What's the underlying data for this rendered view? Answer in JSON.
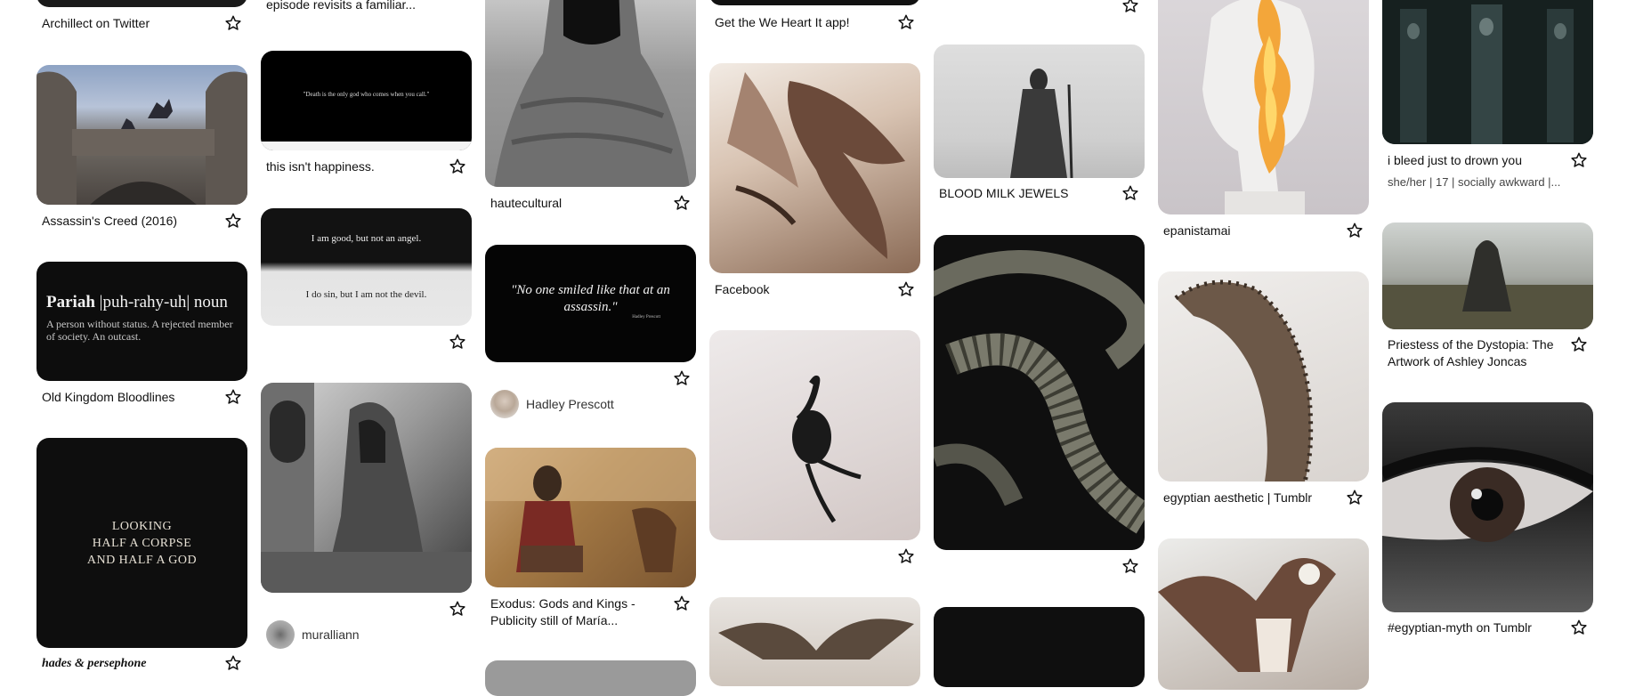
{
  "pins": {
    "c1": {
      "archillect": "Archillect on Twitter",
      "assassins": "Assassin's Creed (2016)",
      "pariah_word": "Pariah",
      "pariah_pron": "|puh-rahy-uh|",
      "pariah_pos": "noun",
      "pariah_def": "A person without status. A rejected member of society. An outcast.",
      "old_kingdom": "Old Kingdom Bloodlines",
      "looking_1": "LOOKING",
      "looking_2": "HALF A CORPSE",
      "looking_3": "AND HALF A GOD",
      "hades": "hades & persephone"
    },
    "c2": {
      "episode": "episode revisits a familiar...",
      "death_quote": "\"Death is the only god who comes when you call.\"",
      "happiness": "this isn't happiness.",
      "good_line1": "I am good, but not an angel.",
      "good_line2": "I do sin, but I am not the devil.",
      "user": "muralliann"
    },
    "c3": {
      "hautecultural": "hautecultural",
      "assassin_quote": "\"No one smiled like that at an assassin.\"",
      "assassin_attr": "Hadley Prescott",
      "user": "Hadley Prescott",
      "exodus": "Exodus: Gods and Kings - Publicity still of María..."
    },
    "c4": {
      "weheartit": "Get the We Heart It app!",
      "facebook": "Facebook"
    },
    "c5": {
      "blood_milk": "BLOOD MILK JEWELS"
    },
    "c6": {
      "epanistamai": "epanistamai",
      "egyptian": "egyptian aesthetic | Tumblr"
    },
    "c7": {
      "bleed": "i bleed just to drown you",
      "bleed_sub": "she/her | 17 | socially awkward |...",
      "priestess": "Priestess of the Dystopia: The Artwork of Ashley Joncas",
      "myth": "#egyptian-myth on Tumblr"
    }
  },
  "icons": {
    "save": "star-outline-icon"
  }
}
